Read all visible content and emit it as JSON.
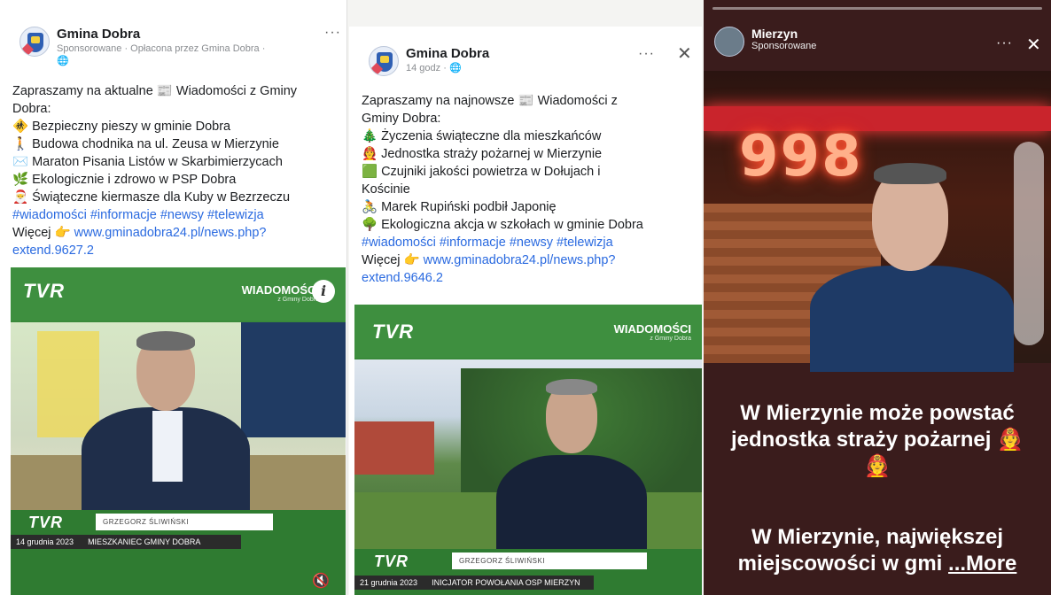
{
  "post1": {
    "page_name": "Gmina Dobra",
    "sub": "Sponsorowane · Opłacona przez Gmina Dobra ·",
    "menu": "···",
    "lines": [
      "Zapraszamy na aktualne 📰 Wiadomości z Gminy",
      "Dobra:",
      "🚸 Bezpieczny pieszy w gminie Dobra",
      "🚶 Budowa chodnika na ul. Zeusa w Mierzynie",
      "✉️ Maraton Pisania Listów w Skarbimierzycach",
      "🌿 Ekologicznie i zdrowo w PSP Dobra",
      "🎅 Świąteczne kiermasze dla Kuby w Bezrzeczu"
    ],
    "hashtags": "#wiadomości #informacje #newsy #telewizja",
    "more_prefix": "Więcej 👉 ",
    "link1": "www.gminadobra24.pl/news.php?",
    "link2": "extend.9627.2",
    "video": {
      "brand": "TVR",
      "program": "WIADOMOŚCI",
      "program_sub": "z Gminy Dobra",
      "lower_brand": "TVR",
      "name": "GRZEGORZ ŚLIWIŃSKI",
      "date": "14 grudnia 2023",
      "role": "MIESZKANIEC GMINY DOBRA",
      "sound_icon": "🔇"
    }
  },
  "post2": {
    "page_name": "Gmina Dobra",
    "sub": "14 godz ·",
    "menu": "···",
    "close": "✕",
    "lines": [
      "Zapraszamy na najnowsze 📰 Wiadomości z",
      "Gminy Dobra:",
      "🎄 Życzenia świąteczne dla mieszkańców",
      "🧑‍🚒 Jednostka straży pożarnej w Mierzynie",
      "🟩 Czujniki jakości powietrza w Dołujach i",
      "Kościnie",
      "🚴 Marek Rupiński podbił Japonię",
      "🌳 Ekologiczna akcja w szkołach w gminie Dobra"
    ],
    "hashtags": "#wiadomości #informacje #newsy #telewizja",
    "more_prefix": "Więcej 👉 ",
    "link1": "www.gminadobra24.pl/news.php?",
    "link2": "extend.9646.2",
    "video": {
      "brand": "TVR",
      "program": "WIADOMOŚCI",
      "program_sub": "z Gminy Dobra",
      "lower_brand": "TVR",
      "name": "GRZEGORZ ŚLIWIŃSKI",
      "date": "21 grudnia 2023",
      "role": "INICJATOR POWOŁANIA OSP MIERZYN"
    }
  },
  "story": {
    "page_name": "Mierzyn",
    "sub": "Sponsorowane",
    "menu": "···",
    "close": "✕",
    "neon": "998",
    "caption1a": "W Mierzynie może powstać",
    "caption1b": "jednostka straży pożarnej 🧑‍🚒",
    "caption1c": "🧑‍🚒",
    "caption2a": "W Mierzynie, największej",
    "caption2b": "miejscowości w gmi",
    "more": "...More"
  }
}
